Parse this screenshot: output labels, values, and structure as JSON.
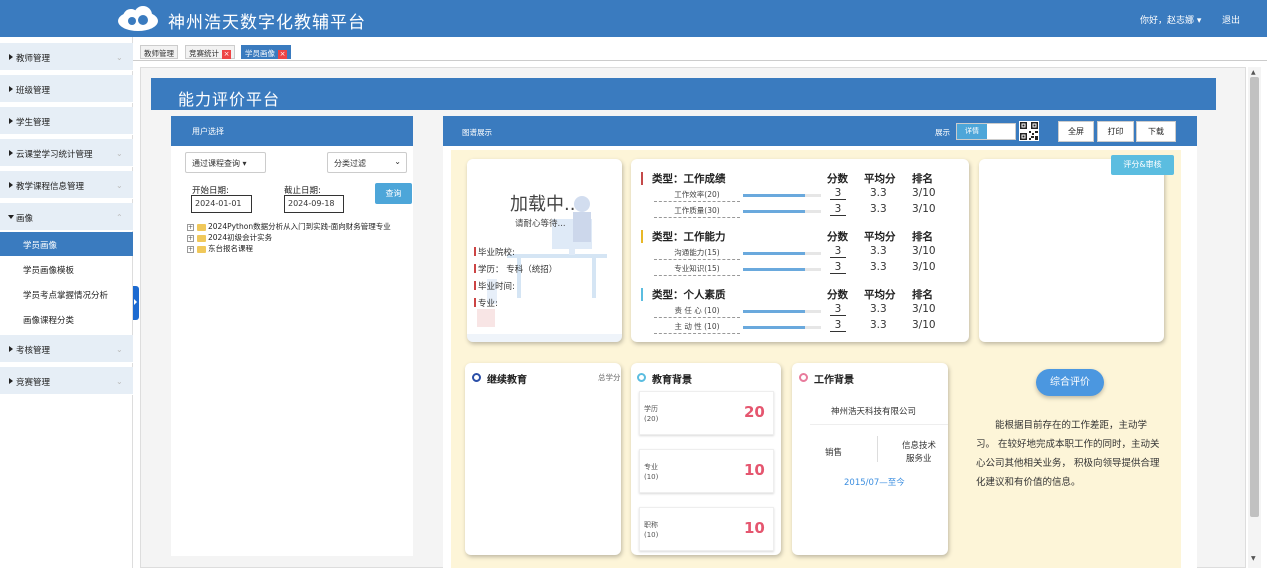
{
  "header": {
    "title": "神州浩天数字化教辅平台",
    "greeting": "你好，赵志娜 ▾",
    "logout": "退出"
  },
  "sidebar": {
    "items": [
      {
        "label": "教师管理",
        "chev": "⌄"
      },
      {
        "label": "班级管理"
      },
      {
        "label": "学生管理"
      },
      {
        "label": "云课堂学习统计管理",
        "chev": "⌄"
      },
      {
        "label": "教学课程信息管理",
        "chev": "⌄"
      },
      {
        "label": "画像",
        "chev": "⌃"
      },
      {
        "label": "考核管理",
        "chev": "⌄"
      },
      {
        "label": "竞赛管理",
        "chev": "⌄"
      }
    ],
    "sub_items": [
      {
        "label": "学员画像"
      },
      {
        "label": "学员画像模板"
      },
      {
        "label": "学员考点掌握情况分析"
      },
      {
        "label": "画像课程分类"
      }
    ]
  },
  "tabs": [
    {
      "label": "教师管理"
    },
    {
      "label": "竞赛统计",
      "close": "×"
    },
    {
      "label": "学员画像",
      "close": "×"
    }
  ],
  "page": {
    "banner_title": "能力评价平台"
  },
  "left_panel": {
    "title": "用户选择",
    "course_query": "通过课程查询 ▾",
    "category_filter": "分类过滤",
    "start_label": "开始日期:",
    "end_label": "截止日期:",
    "start_date": "2024-01-01",
    "end_date": "2024-09-18",
    "query_btn": "查询",
    "tree": [
      {
        "label": "2024Python数据分析从入门到实践-面向财务管理专业",
        "toggle": "+"
      },
      {
        "label": "2024初级会计实务",
        "toggle": "+"
      },
      {
        "label": "东台报名课程",
        "toggle": "+"
      }
    ]
  },
  "right_panel": {
    "title": "图谱展示",
    "show_label": "展示",
    "toggle_on": "详情",
    "buttons": {
      "fullscreen": "全屏",
      "print": "打印",
      "download": "下载"
    },
    "review_btn": "评分&审核"
  },
  "profile": {
    "loading": "加载中..",
    "wait": "请耐心等待...",
    "fields": [
      "毕业院校:",
      "学历： 专科（统招）",
      "毕业时间:",
      "专业:"
    ]
  },
  "scores": {
    "col_score": "分数",
    "col_avg": "平均分",
    "col_rank": "排名",
    "sections": [
      {
        "title": "类型：工作成绩",
        "color": "#c44a4a",
        "items": [
          {
            "label": "工作效率(20)",
            "score": "3",
            "avg": "3.3",
            "rank": "3/10",
            "fill": 0.8
          },
          {
            "label": "工作质量(30)",
            "score": "3",
            "avg": "3.3",
            "rank": "3/10",
            "fill": 0.8
          }
        ]
      },
      {
        "title": "类型：工作能力",
        "color": "#e8b828",
        "items": [
          {
            "label": "沟通能力(15)",
            "score": "3",
            "avg": "3.3",
            "rank": "3/10",
            "fill": 0.8
          },
          {
            "label": "专业知识(15)",
            "score": "3",
            "avg": "3.3",
            "rank": "3/10",
            "fill": 0.8
          }
        ]
      },
      {
        "title": "类型：个人素质",
        "color": "#5bbde0",
        "items": [
          {
            "label": "责 任 心 (10)",
            "score": "3",
            "avg": "3.3",
            "rank": "3/10",
            "fill": 0.8
          },
          {
            "label": "主 动 性 (10)",
            "score": "3",
            "avg": "3.3",
            "rank": "3/10",
            "fill": 0.8
          }
        ]
      }
    ]
  },
  "continuing": {
    "title": "继续教育",
    "total": "总学分"
  },
  "edu_bg": {
    "title": "教育背景",
    "rows": [
      {
        "label1": "学历",
        "label2": "(20)",
        "value": "20"
      },
      {
        "label1": "专业",
        "label2": "(10)",
        "value": "10"
      },
      {
        "label1": "职称",
        "label2": "(10)",
        "value": "10"
      }
    ]
  },
  "work_bg": {
    "title": "工作背景",
    "company": "神州浩天科技有限公司",
    "position": "销售",
    "dept1": "信息技术",
    "dept2": "服务业",
    "period": "2015/07—至今"
  },
  "evaluation": {
    "btn": "综合评价",
    "text": "能根据目前存在的工作差距，主动学习。 在较好地完成本职工作的同时，主动关心公司其他相关业务， 积极向领导提供合理化建议和有价值的信息。"
  },
  "colors": {
    "primary": "#3a7bbf",
    "accent": "#4da6d9",
    "highlight_value": "#e5566f",
    "panel_bg": "#fdf5d8"
  }
}
